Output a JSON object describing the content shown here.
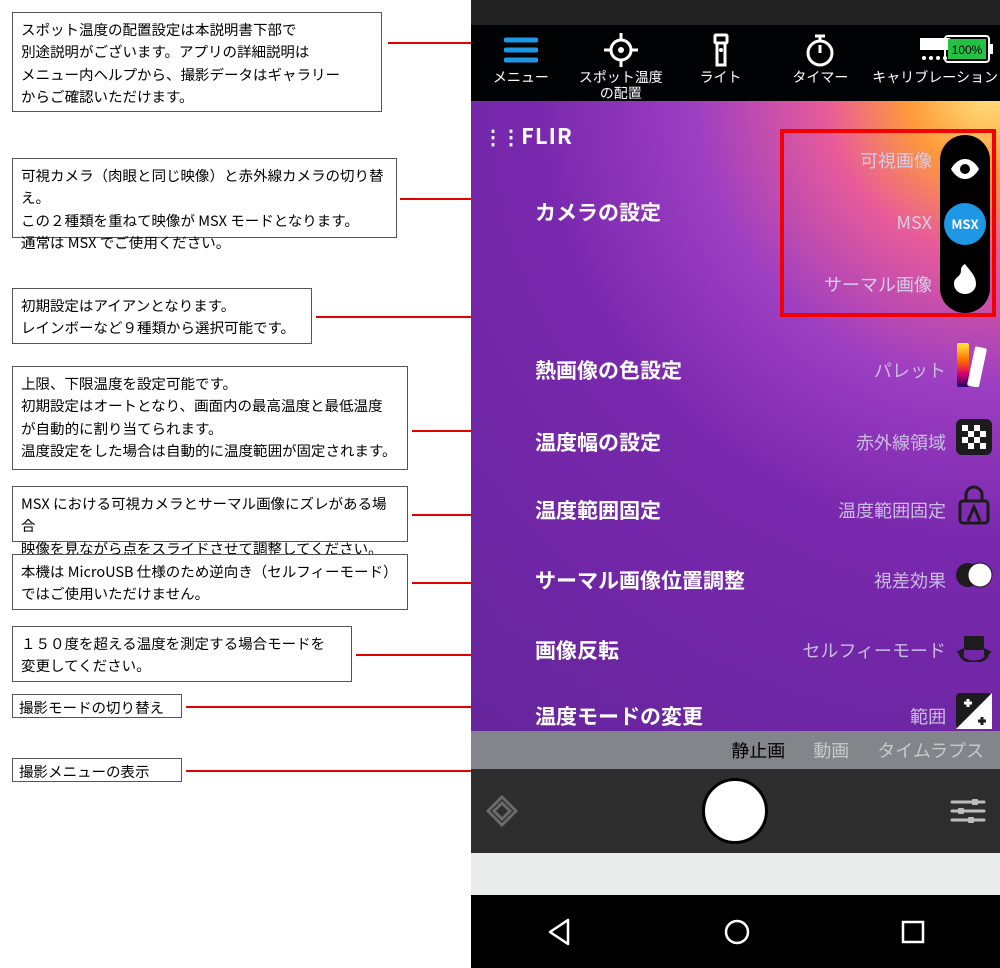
{
  "annotations": {
    "a1": "スポット温度の配置設定は本説明書下部で\n別途説明がございます。アプリの詳細説明は\nメニュー内ヘルプから、撮影データはギャラリー\nからご確認いただけます。",
    "a2": "可視カメラ（肉眼と同じ映像）と赤外線カメラの切り替え。\nこの２種類を重ねて映像が MSX モードとなります。\n通常は MSX でご使用ください。",
    "a3": "初期設定はアイアンとなります。\nレインボーなど９種類から選択可能です。",
    "a4": "上限、下限温度を設定可能です。\n初期設定はオートとなり、画面内の最高温度と最低温度\nが自動的に割り当てられます。\n温度設定をした場合は自動的に温度範囲が固定されます。",
    "a5": "MSX における可視カメラとサーマル画像にズレがある場合\n映像を見ながら点をスライドさせて調整してください。",
    "a6": "本機は MicroUSB 仕様のため逆向き（セルフィーモード）\nではご使用いただけません。",
    "a7": "１５０度を超える温度を測定する場合モードを\n変更してください。",
    "a8": "撮影モードの切り替え",
    "a9": "撮影メニューの表示"
  },
  "toolbar": {
    "menu": "メニュー",
    "spot": "スポット温度\nの配置",
    "light": "ライト",
    "timer": "タイマー",
    "calib": "キャリブレーション"
  },
  "logo": "FLIR",
  "battery_pct": "100%",
  "modes": {
    "visible": "可視画像",
    "msx_label": "MSX",
    "msx_badge": "MSX",
    "thermal": "サーマル画像"
  },
  "rows": {
    "cam": {
      "title": "カメラの設定",
      "sub": ""
    },
    "palette": {
      "title": "熱画像の色設定",
      "sub": "パレット"
    },
    "span": {
      "title": "温度幅の設定",
      "sub": "赤外線領域"
    },
    "lock": {
      "title": "温度範囲固定",
      "sub": "温度範囲固定"
    },
    "align": {
      "title": "サーマル画像位置調整",
      "sub": "視差効果"
    },
    "flip": {
      "title": "画像反転",
      "sub": "セルフィーモード"
    },
    "range": {
      "title": "温度モードの変更",
      "sub": "範囲"
    }
  },
  "capture_tabs": {
    "still": "静止画",
    "video": "動画",
    "timelapse": "タイムラプス"
  }
}
